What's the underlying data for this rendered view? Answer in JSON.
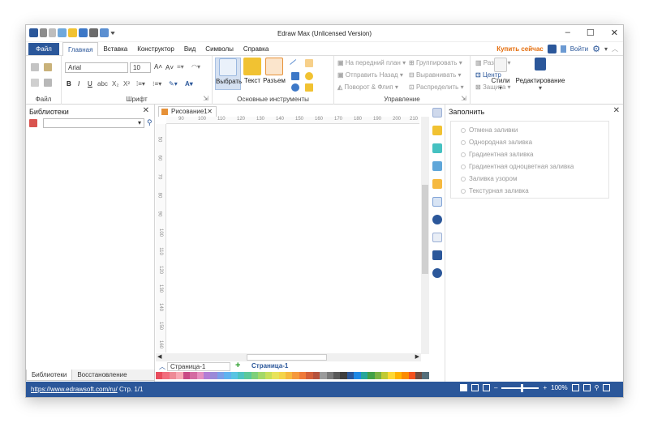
{
  "window": {
    "title": "Edraw Max (Unlicensed Version)"
  },
  "menu": {
    "file": "Файл",
    "items": [
      "Главная",
      "Вставка",
      "Конструктор",
      "Вид",
      "Символы",
      "Справка"
    ],
    "buy": "Купить сейчас",
    "login": "Войти"
  },
  "ribbon": {
    "file_group": "Файл",
    "font_group": "Шрифт",
    "font_name": "Arial",
    "font_size": "10",
    "tools_group": "Основные инструменты",
    "select": "Выбрать",
    "text": "Текст",
    "connector": "Разъем",
    "manage_group": "Управление",
    "bring_front": "На передний план",
    "send_back": "Отправить Назад",
    "rotate": "Поворот & Флип",
    "group": "Группировать",
    "align": "Выравнивать",
    "distribute": "Распределить",
    "size": "Размер",
    "center": "Центр",
    "protect": "Защита",
    "styles": "Стили",
    "editing": "Редактирование"
  },
  "libraries": {
    "title": "Библиотеки",
    "tab_libraries": "Библиотеки",
    "tab_restore": "Восстановление файлов"
  },
  "document": {
    "tab": "Рисование1",
    "ruler_top": [
      "90",
      "100",
      "110",
      "120",
      "130",
      "140",
      "150",
      "160",
      "170",
      "180",
      "190",
      "200",
      "210"
    ],
    "ruler_left": [
      "50",
      "60",
      "70",
      "80",
      "90",
      "100",
      "110",
      "120",
      "130",
      "140",
      "150",
      "160"
    ],
    "page_select": "Страница-1",
    "page_tab": "Страница-1"
  },
  "fill": {
    "title": "Заполнить",
    "options": [
      "Отмена заливки",
      "Однородная заливка",
      "Градиентная заливка",
      "Градиентная одноцветная заливка",
      "Заливка узором",
      "Текстурная заливка"
    ]
  },
  "status": {
    "link": "https://www.edrawsoft.com/ru/",
    "page": "Стр. 1/1",
    "zoom": "100%"
  },
  "palette_colors": [
    "#e84c5c",
    "#f26d7d",
    "#ee8a96",
    "#f7a9b4",
    "#c94a84",
    "#d46aa2",
    "#e690c0",
    "#b27ed5",
    "#9b8ad8",
    "#7a9fe8",
    "#5fb2ef",
    "#59c4e3",
    "#4ec4c1",
    "#5cc99a",
    "#7ed07a",
    "#a4d868",
    "#c8df5a",
    "#e8e35a",
    "#f4d44a",
    "#f6b93f",
    "#f5993c",
    "#ef7a3a",
    "#d35f3a",
    "#b5523c",
    "#9b9b9b",
    "#7a7a7a",
    "#5a5a5a",
    "#3f3f3f",
    "#2b579a",
    "#1e88e5",
    "#26a69a",
    "#43a047",
    "#7cb342",
    "#c0ca33",
    "#fdd835",
    "#ffb300",
    "#fb8c00",
    "#f4511e",
    "#6d4c41",
    "#546e7a"
  ]
}
